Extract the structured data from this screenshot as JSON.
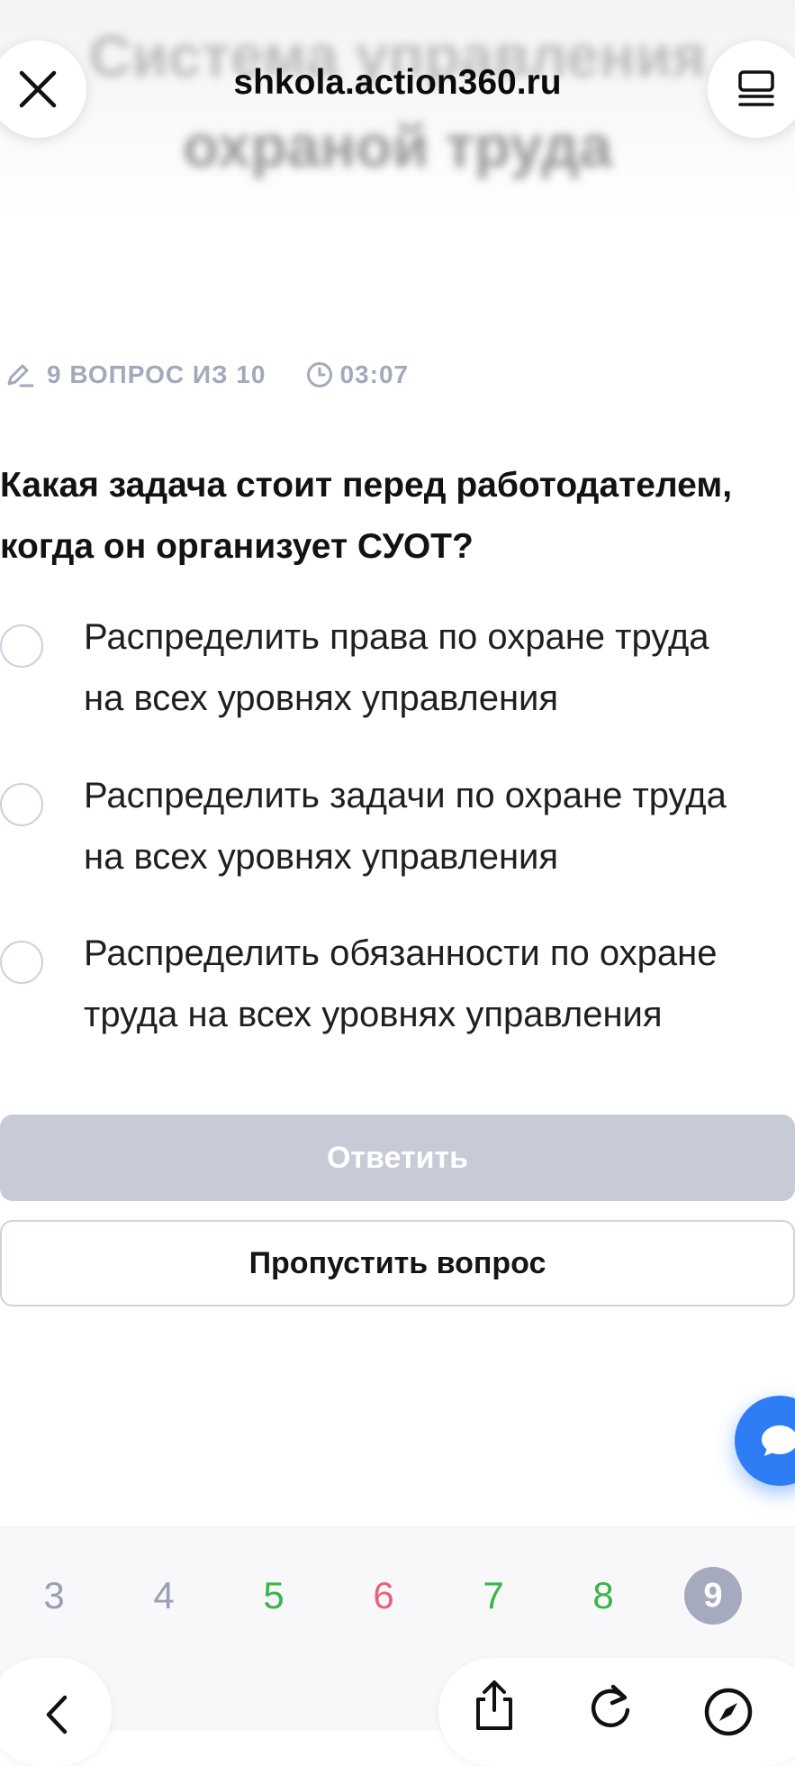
{
  "browser": {
    "url": "shkola.action360.ru",
    "background_title_line1": "Система управления",
    "background_title_line2": "охраной труда"
  },
  "quiz": {
    "progress_text": "9 ВОПРОС ИЗ 10",
    "timer": "03:07",
    "question_line1": "Какая задача стоит перед работодателем,",
    "question_line2": "когда он организует СУОТ?",
    "options": [
      {
        "line1": "Распределить права по охране труда",
        "line2": "на всех уровнях управления"
      },
      {
        "line1": "Распределить задачи по охране труда",
        "line2": "на всех уровнях управления"
      },
      {
        "line1": "Распределить обязанности по охране",
        "line2": "труда на всех уровнях управления"
      }
    ],
    "answer_button": "Ответить",
    "skip_button": "Пропустить вопрос"
  },
  "pager": {
    "items": [
      {
        "label": "3",
        "color": "#9a9fb6"
      },
      {
        "label": "4",
        "color": "#9a9fb6"
      },
      {
        "label": "5",
        "color": "#3bb54a"
      },
      {
        "label": "6",
        "color": "#e8627b"
      },
      {
        "label": "7",
        "color": "#3bb54a"
      },
      {
        "label": "8",
        "color": "#3bb54a"
      },
      {
        "label": "9",
        "color": "#ffffff"
      }
    ],
    "current": "9"
  },
  "colors": {
    "accent_blue": "#2f7df5",
    "muted_gray": "#a3a8bc",
    "correct_green": "#3bb54a",
    "wrong_red": "#e8627b",
    "disabled_button": "#c7cad7"
  },
  "icons": {
    "close": "close-icon",
    "tabs": "tabs-icon",
    "pencil": "pencil-icon",
    "timer": "clock-icon",
    "chat": "chat-icon",
    "back": "chevron-left-icon",
    "share": "share-icon",
    "reload": "reload-icon",
    "compass": "compass-icon"
  }
}
